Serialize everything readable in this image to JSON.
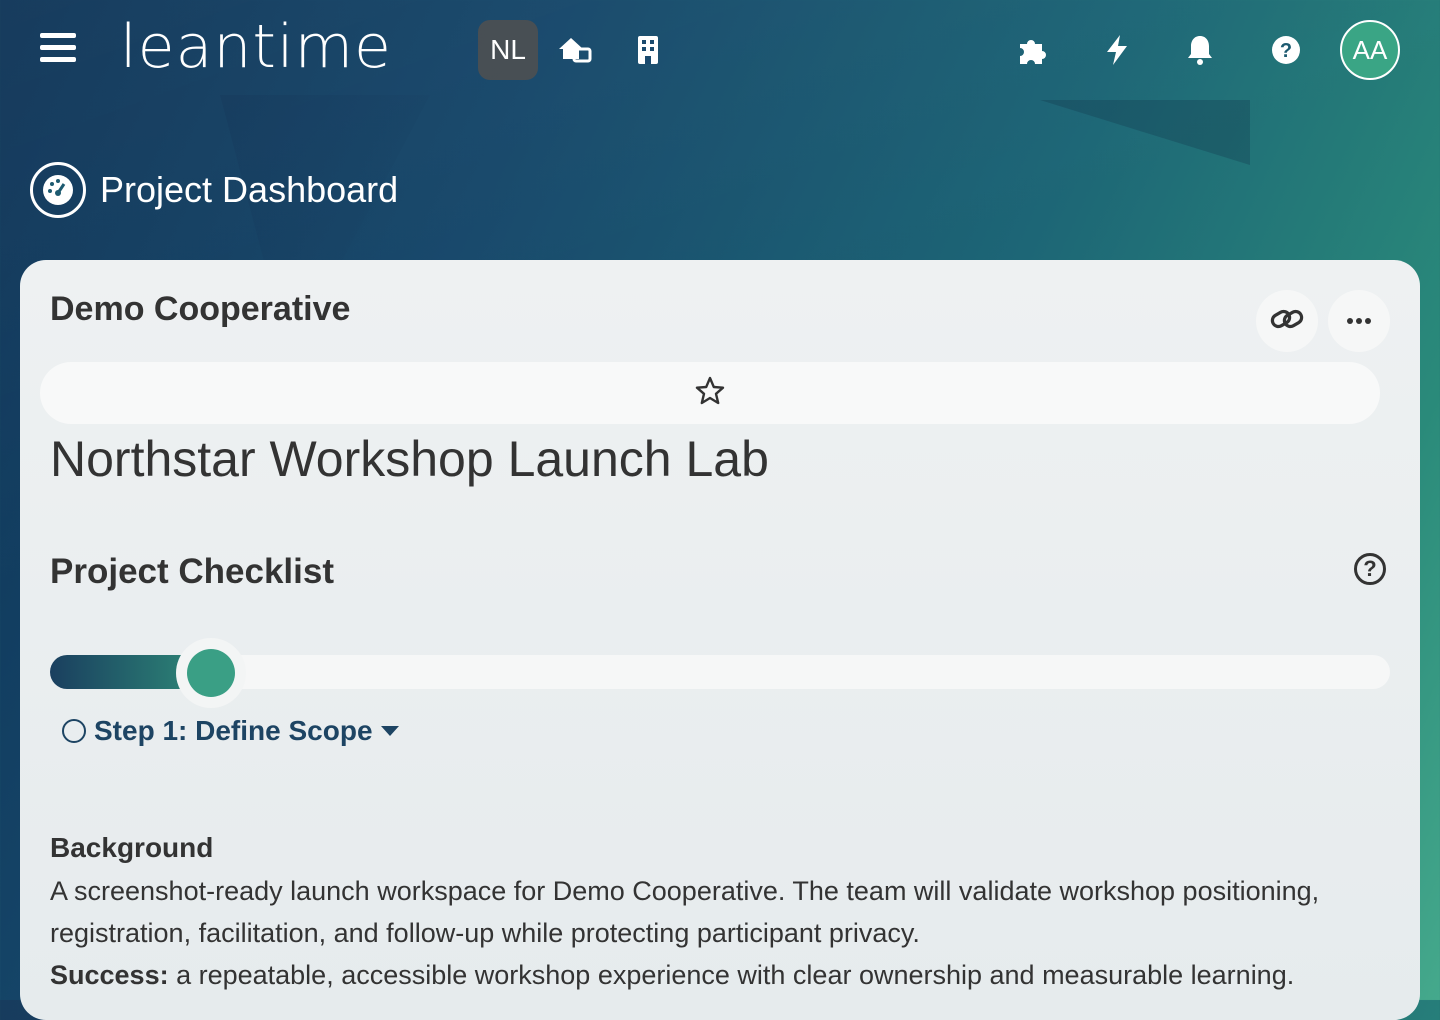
{
  "app": {
    "logo_text": "leantime"
  },
  "topbar": {
    "project_badge": "NL",
    "avatar_initials": "AA",
    "icons": [
      "hamburger-menu-icon",
      "home-icon",
      "building-icon",
      "puzzle-icon",
      "bolt-icon",
      "bell-icon",
      "help-icon"
    ]
  },
  "page": {
    "title": "Project Dashboard"
  },
  "card": {
    "org_name": "Demo Cooperative",
    "project_name": "Northstar Workshop Launch Lab",
    "checklist_title": "Project Checklist",
    "progress_percent": 12,
    "current_step": "Step 1: Define Scope",
    "background_heading": "Background",
    "background_text": "A screenshot-ready launch workspace for Demo Cooperative. The team will validate workshop positioning, registration, facilitation, and follow-up while protecting participant privacy.",
    "success_label": "Success:",
    "success_text": " a repeatable, accessible workshop experience with clear ownership and measurable learning."
  },
  "colors": {
    "accent": "#3a9f85",
    "step_text": "#1d4463"
  }
}
